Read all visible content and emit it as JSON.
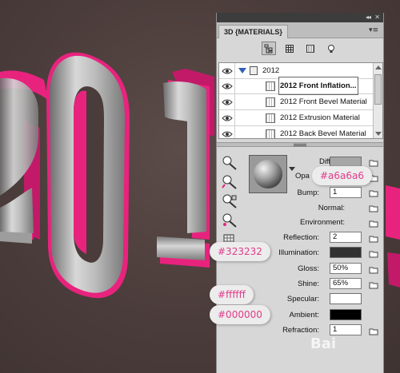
{
  "panel": {
    "tab_title": "3D {MATERIALS}",
    "collapse_glyph": "◂◂",
    "close_glyph": "✕",
    "menu_glyph": "▾≡"
  },
  "toolbar": {
    "icons": [
      "scene-filter-icon",
      "mesh-filter-icon",
      "material-filter-icon",
      "light-filter-icon"
    ]
  },
  "layers": {
    "group": {
      "label": "2012"
    },
    "items": [
      {
        "label": "2012 Front Inflation...",
        "selected": true
      },
      {
        "label": "2012 Front Bevel Material",
        "selected": false
      },
      {
        "label": "2012 Extrusion Material",
        "selected": false
      },
      {
        "label": "2012 Back Bevel Material",
        "selected": false
      }
    ]
  },
  "material": {
    "diffuse": {
      "label": "Diffuse:",
      "color": "#a6a6a6"
    },
    "opacity": {
      "label": "Opa"
    },
    "bump": {
      "label": "Bump:",
      "value": "1"
    },
    "normal": {
      "label": "Normal:"
    },
    "environment": {
      "label": "Environment:"
    },
    "reflection": {
      "label": "Reflection:",
      "value": "2"
    },
    "illumination": {
      "label": "Illumination:",
      "color": "#323232"
    },
    "gloss": {
      "label": "Gloss:",
      "value": "50%"
    },
    "shine": {
      "label": "Shine:",
      "value": "65%"
    },
    "specular": {
      "label": "Specular:",
      "color": "#ffffff"
    },
    "ambient": {
      "label": "Ambient:",
      "color": "#000000"
    },
    "refraction": {
      "label": "Refraction:",
      "value": "1"
    }
  },
  "callouts": {
    "diffuse": "#a6a6a6",
    "illumination": "#323232",
    "specular": "#ffffff",
    "ambient": "#000000"
  },
  "watermark": "Bai",
  "colors": {
    "text_magenta": "#e8237e",
    "text_gray": "#9c9c9c",
    "accent_callout": "#e03c8a"
  }
}
